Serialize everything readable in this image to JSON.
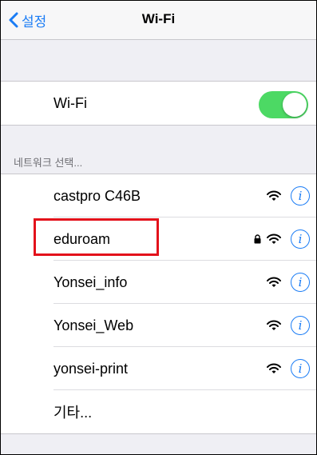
{
  "navbar": {
    "back_label": "설정",
    "title": "Wi-Fi"
  },
  "wifi_toggle": {
    "label": "Wi-Fi",
    "on": true,
    "color": "#4cd964"
  },
  "networks_header": "네트워크 선택...",
  "networks": [
    {
      "name": "castpro C46B",
      "locked": false
    },
    {
      "name": "eduroam",
      "locked": true
    },
    {
      "name": "Yonsei_info",
      "locked": false
    },
    {
      "name": "Yonsei_Web",
      "locked": false
    },
    {
      "name": "yonsei-print",
      "locked": false
    }
  ],
  "other_label": "기타...",
  "icons": {
    "back": "chevron-left-icon",
    "wifi": "wifi-icon",
    "lock": "lock-icon",
    "info": "info-icon"
  },
  "info_glyph": "i",
  "colors": {
    "accent": "#1a7cf5",
    "highlight": "#e3121b",
    "background": "#efeff4"
  }
}
